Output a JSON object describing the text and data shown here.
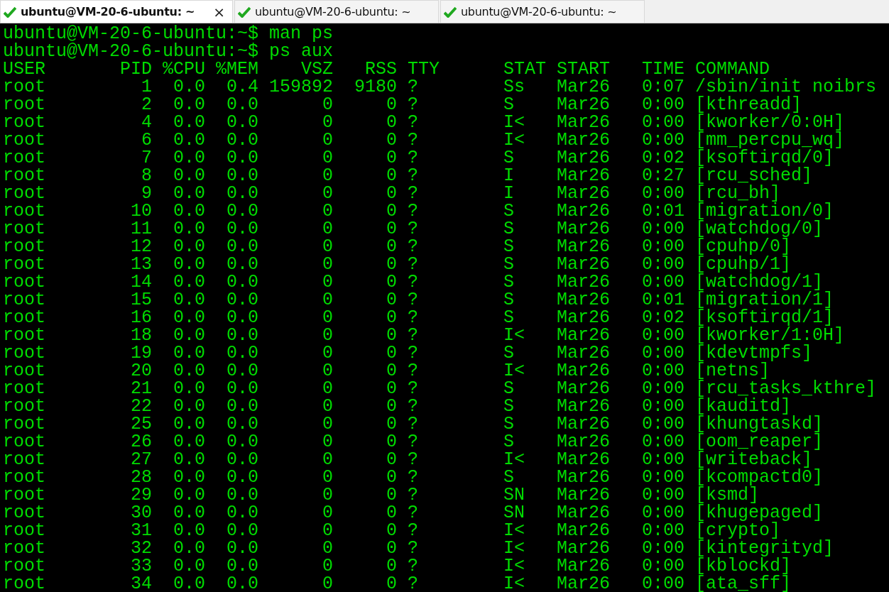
{
  "tabs": [
    {
      "label": "ubuntu@VM-20-6-ubuntu: ~",
      "selected": true,
      "close": "×"
    },
    {
      "label": "ubuntu@VM-20-6-ubuntu: ~",
      "selected": false
    },
    {
      "label": "ubuntu@VM-20-6-ubuntu: ~",
      "selected": false
    }
  ],
  "terminal": {
    "commands": [
      {
        "prompt": "ubuntu@VM-20-6-ubuntu:~$",
        "command": "man ps"
      },
      {
        "prompt": "ubuntu@VM-20-6-ubuntu:~$",
        "command": "ps aux"
      }
    ],
    "columns": [
      "USER",
      "PID",
      "%CPU",
      "%MEM",
      "VSZ",
      "RSS",
      "TTY",
      "STAT",
      "START",
      "TIME",
      "COMMAND"
    ],
    "rows": [
      [
        "root",
        "1",
        "0.0",
        "0.4",
        "159892",
        "9180",
        "?",
        "Ss",
        "Mar26",
        "0:07",
        "/sbin/init noibrs"
      ],
      [
        "root",
        "2",
        "0.0",
        "0.0",
        "0",
        "0",
        "?",
        "S",
        "Mar26",
        "0:00",
        "[kthreadd]"
      ],
      [
        "root",
        "4",
        "0.0",
        "0.0",
        "0",
        "0",
        "?",
        "I<",
        "Mar26",
        "0:00",
        "[kworker/0:0H]"
      ],
      [
        "root",
        "6",
        "0.0",
        "0.0",
        "0",
        "0",
        "?",
        "I<",
        "Mar26",
        "0:00",
        "[mm_percpu_wq]"
      ],
      [
        "root",
        "7",
        "0.0",
        "0.0",
        "0",
        "0",
        "?",
        "S",
        "Mar26",
        "0:02",
        "[ksoftirqd/0]"
      ],
      [
        "root",
        "8",
        "0.0",
        "0.0",
        "0",
        "0",
        "?",
        "I",
        "Mar26",
        "0:27",
        "[rcu_sched]"
      ],
      [
        "root",
        "9",
        "0.0",
        "0.0",
        "0",
        "0",
        "?",
        "I",
        "Mar26",
        "0:00",
        "[rcu_bh]"
      ],
      [
        "root",
        "10",
        "0.0",
        "0.0",
        "0",
        "0",
        "?",
        "S",
        "Mar26",
        "0:01",
        "[migration/0]"
      ],
      [
        "root",
        "11",
        "0.0",
        "0.0",
        "0",
        "0",
        "?",
        "S",
        "Mar26",
        "0:00",
        "[watchdog/0]"
      ],
      [
        "root",
        "12",
        "0.0",
        "0.0",
        "0",
        "0",
        "?",
        "S",
        "Mar26",
        "0:00",
        "[cpuhp/0]"
      ],
      [
        "root",
        "13",
        "0.0",
        "0.0",
        "0",
        "0",
        "?",
        "S",
        "Mar26",
        "0:00",
        "[cpuhp/1]"
      ],
      [
        "root",
        "14",
        "0.0",
        "0.0",
        "0",
        "0",
        "?",
        "S",
        "Mar26",
        "0:00",
        "[watchdog/1]"
      ],
      [
        "root",
        "15",
        "0.0",
        "0.0",
        "0",
        "0",
        "?",
        "S",
        "Mar26",
        "0:01",
        "[migration/1]"
      ],
      [
        "root",
        "16",
        "0.0",
        "0.0",
        "0",
        "0",
        "?",
        "S",
        "Mar26",
        "0:02",
        "[ksoftirqd/1]"
      ],
      [
        "root",
        "18",
        "0.0",
        "0.0",
        "0",
        "0",
        "?",
        "I<",
        "Mar26",
        "0:00",
        "[kworker/1:0H]"
      ],
      [
        "root",
        "19",
        "0.0",
        "0.0",
        "0",
        "0",
        "?",
        "S",
        "Mar26",
        "0:00",
        "[kdevtmpfs]"
      ],
      [
        "root",
        "20",
        "0.0",
        "0.0",
        "0",
        "0",
        "?",
        "I<",
        "Mar26",
        "0:00",
        "[netns]"
      ],
      [
        "root",
        "21",
        "0.0",
        "0.0",
        "0",
        "0",
        "?",
        "S",
        "Mar26",
        "0:00",
        "[rcu_tasks_kthre]"
      ],
      [
        "root",
        "22",
        "0.0",
        "0.0",
        "0",
        "0",
        "?",
        "S",
        "Mar26",
        "0:00",
        "[kauditd]"
      ],
      [
        "root",
        "25",
        "0.0",
        "0.0",
        "0",
        "0",
        "?",
        "S",
        "Mar26",
        "0:00",
        "[khungtaskd]"
      ],
      [
        "root",
        "26",
        "0.0",
        "0.0",
        "0",
        "0",
        "?",
        "S",
        "Mar26",
        "0:00",
        "[oom_reaper]"
      ],
      [
        "root",
        "27",
        "0.0",
        "0.0",
        "0",
        "0",
        "?",
        "I<",
        "Mar26",
        "0:00",
        "[writeback]"
      ],
      [
        "root",
        "28",
        "0.0",
        "0.0",
        "0",
        "0",
        "?",
        "S",
        "Mar26",
        "0:00",
        "[kcompactd0]"
      ],
      [
        "root",
        "29",
        "0.0",
        "0.0",
        "0",
        "0",
        "?",
        "SN",
        "Mar26",
        "0:00",
        "[ksmd]"
      ],
      [
        "root",
        "30",
        "0.0",
        "0.0",
        "0",
        "0",
        "?",
        "SN",
        "Mar26",
        "0:00",
        "[khugepaged]"
      ],
      [
        "root",
        "31",
        "0.0",
        "0.0",
        "0",
        "0",
        "?",
        "I<",
        "Mar26",
        "0:00",
        "[crypto]"
      ],
      [
        "root",
        "32",
        "0.0",
        "0.0",
        "0",
        "0",
        "?",
        "I<",
        "Mar26",
        "0:00",
        "[kintegrityd]"
      ],
      [
        "root",
        "33",
        "0.0",
        "0.0",
        "0",
        "0",
        "?",
        "I<",
        "Mar26",
        "0:00",
        "[kblockd]"
      ],
      [
        "root",
        "34",
        "0.0",
        "0.0",
        "0",
        "0",
        "?",
        "I<",
        "Mar26",
        "0:00",
        "[ata_sff]"
      ]
    ]
  }
}
